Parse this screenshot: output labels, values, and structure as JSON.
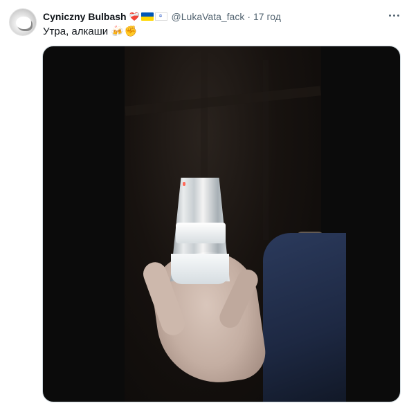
{
  "tweet": {
    "display_name": "Cyniczny Bulbash",
    "handle": "@LukaVata_fack",
    "separator": "·",
    "time": "17 год",
    "text": "Утра, алкаши",
    "badges": {
      "heart": "❤️‍🩹",
      "ukraine_flag_colors": [
        "#0057b7",
        "#ffd700"
      ],
      "israel_flag_color": "#0038b8"
    },
    "emojis": [
      "🍻",
      "✊"
    ],
    "more_icon": "more-horizontal-icon",
    "media": {
      "type": "video"
    }
  },
  "colors": {
    "text_primary": "#0f1419",
    "text_secondary": "#536471",
    "media_bg": "#0b0b0b"
  }
}
